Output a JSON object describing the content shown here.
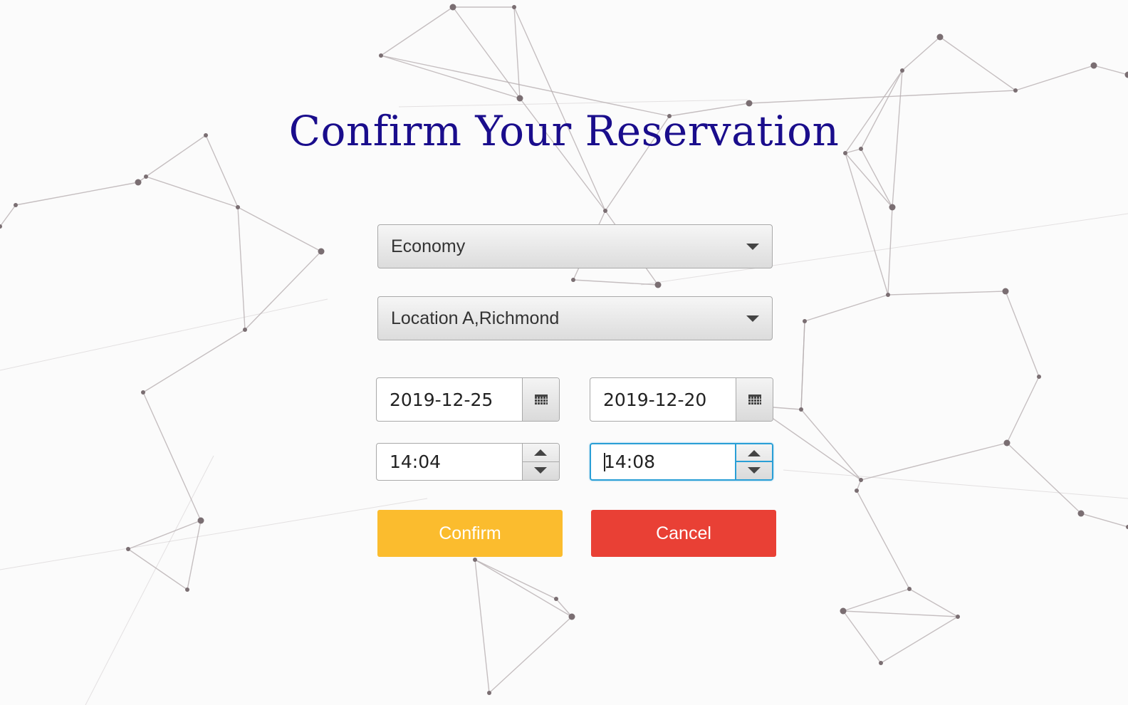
{
  "page": {
    "title": "Confirm Your Reservation"
  },
  "form": {
    "car_class": {
      "value": "Economy"
    },
    "location": {
      "value": "Location A,Richmond"
    },
    "pickup_date": {
      "value": "2019-12-25"
    },
    "return_date": {
      "value": "2019-12-20"
    },
    "pickup_time": {
      "value": "14:04"
    },
    "return_time": {
      "value": "14:08"
    }
  },
  "buttons": {
    "confirm_label": "Confirm",
    "cancel_label": "Cancel"
  },
  "colors": {
    "title": "#1a0d8c",
    "confirm": "#fbbc2e",
    "cancel": "#e94035",
    "focus": "#2a9fd6",
    "network_line": "#b8b0b2",
    "network_node": "#7a6e72"
  },
  "icons": {
    "dropdown": "chevron-down-icon",
    "date_picker": "calendar-icon",
    "spinner_up": "arrow-up-icon",
    "spinner_down": "arrow-down-icon"
  }
}
